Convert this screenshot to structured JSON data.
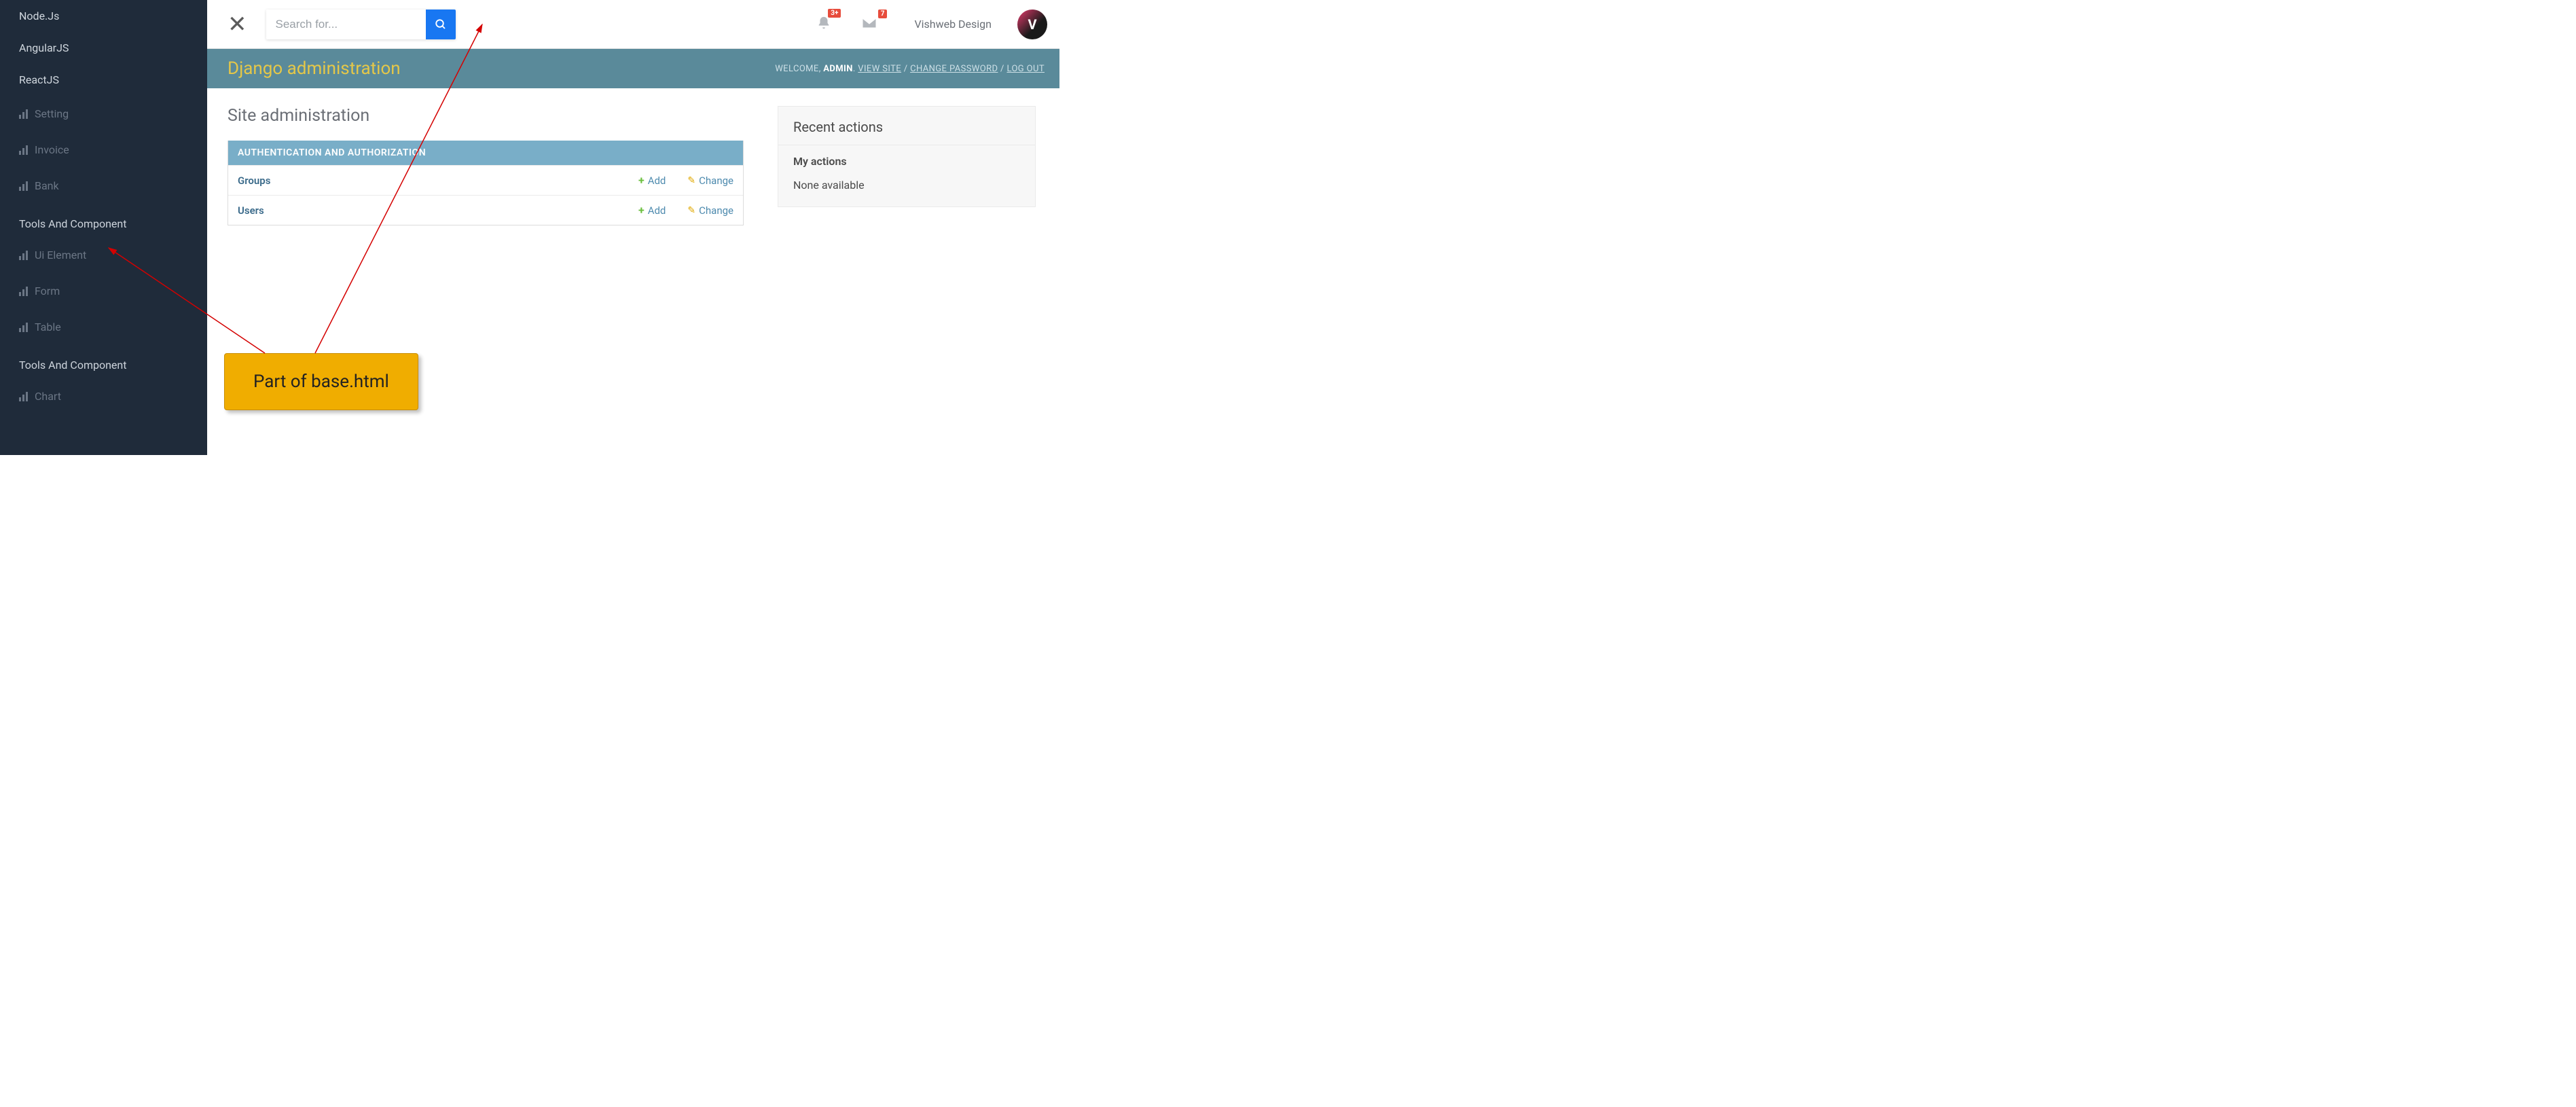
{
  "sidebar": {
    "top_items": [
      "Node.Js",
      "AngularJS",
      "ReactJS"
    ],
    "section1": [
      "Setting",
      "Invoice",
      "Bank"
    ],
    "heading1": "Tools And Component",
    "section2": [
      "Ui Element",
      "Form",
      "Table"
    ],
    "heading2": "Tools And Component",
    "section3": [
      "Chart"
    ]
  },
  "topbar": {
    "search_placeholder": "Search for...",
    "bell_badge": "3+",
    "mail_badge": "7",
    "username": "Vishweb Design",
    "avatar_initial": "V"
  },
  "django": {
    "title": "Django administration",
    "welcome": "WELCOME, ",
    "admin": "ADMIN",
    "view_site": "VIEW SITE",
    "change_password": "CHANGE PASSWORD",
    "log_out": "LOG OUT",
    "site_title": "Site administration",
    "module_header": "AUTHENTICATION AND AUTHORIZATION",
    "models": [
      {
        "name": "Groups",
        "add": "Add",
        "change": "Change"
      },
      {
        "name": "Users",
        "add": "Add",
        "change": "Change"
      }
    ],
    "recent_title": "Recent actions",
    "recent_sub": "My actions",
    "recent_none": "None available"
  },
  "callout": "Part of base.html"
}
